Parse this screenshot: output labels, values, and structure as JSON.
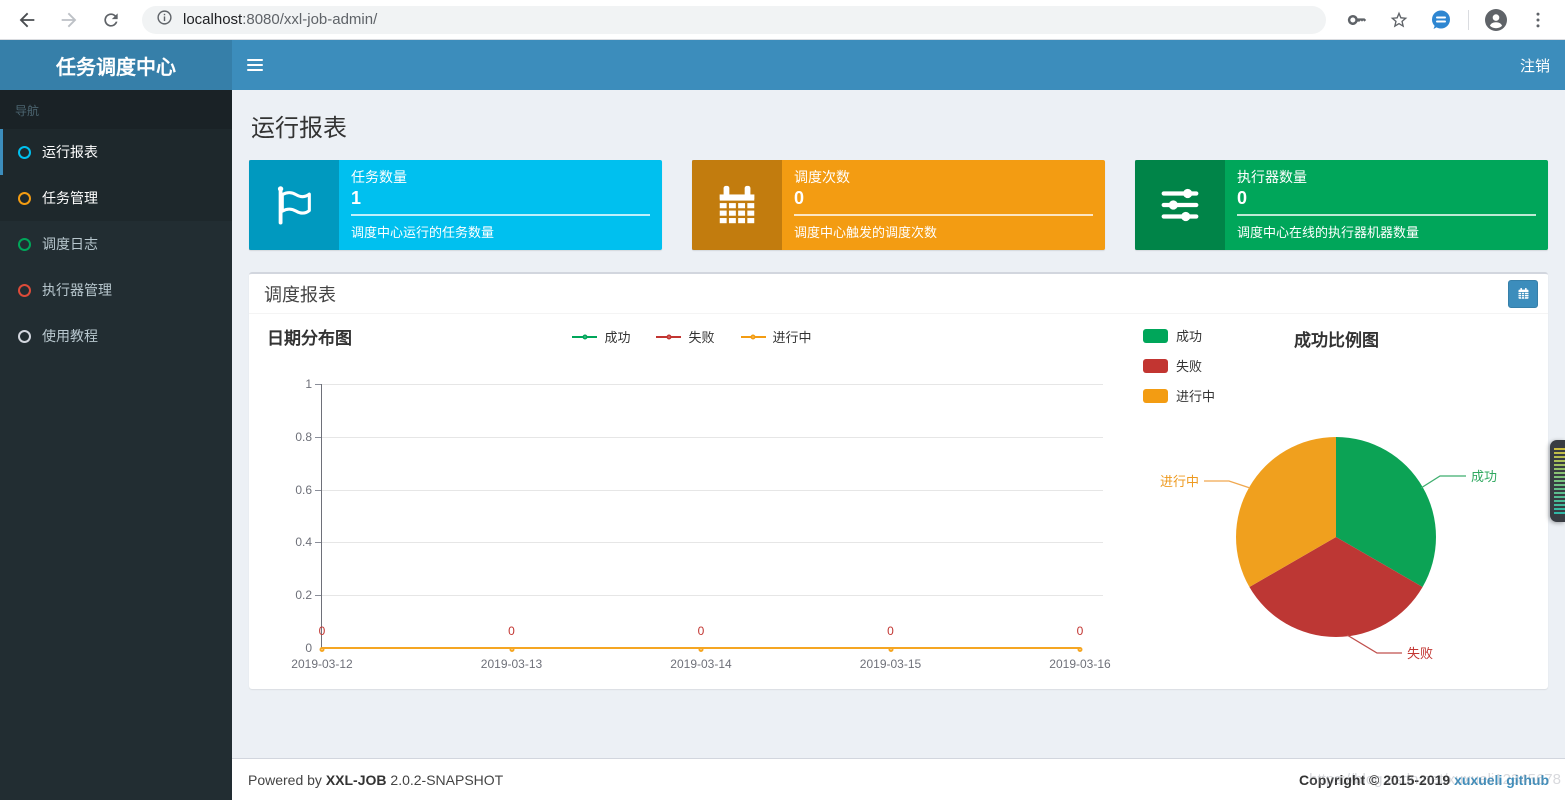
{
  "browser": {
    "url_host": "localhost",
    "url_rest": ":8080/xxl-job-admin/"
  },
  "navbar": {
    "title": "任务调度中心",
    "logout_label": "注销"
  },
  "sidebar": {
    "header": "导航",
    "items": [
      {
        "label": "运行报表",
        "icon_color": "#00c0ef",
        "active": true
      },
      {
        "label": "任务管理",
        "icon_color": "#f39c12",
        "active": false
      },
      {
        "label": "调度日志",
        "icon_color": "#00a65a",
        "active": false
      },
      {
        "label": "执行器管理",
        "icon_color": "#dd4b39",
        "active": false
      },
      {
        "label": "使用教程",
        "icon_color": "#d2d6de",
        "active": false
      }
    ]
  },
  "page": {
    "title": "运行报表"
  },
  "stat_cards": [
    {
      "label": "任务数量",
      "value": "1",
      "desc": "调度中心运行的任务数量",
      "color": "#00c0ef",
      "icon": "flag-icon"
    },
    {
      "label": "调度次数",
      "value": "0",
      "desc": "调度中心触发的调度次数",
      "color": "#f39c12",
      "icon": "calendar-icon"
    },
    {
      "label": "执行器数量",
      "value": "0",
      "desc": "调度中心在线的执行器机器数量",
      "color": "#00a65a",
      "icon": "sliders-icon"
    }
  ],
  "panel": {
    "title": "调度报表"
  },
  "chart_data": [
    {
      "type": "line",
      "title": "日期分布图",
      "x": [
        "2019-03-12",
        "2019-03-13",
        "2019-03-14",
        "2019-03-15",
        "2019-03-16"
      ],
      "series": [
        {
          "name": "成功",
          "color": "#00a65a",
          "values": [
            0,
            0,
            0,
            0,
            0
          ]
        },
        {
          "name": "失败",
          "color": "#c23531",
          "values": [
            0,
            0,
            0,
            0,
            0
          ]
        },
        {
          "name": "进行中",
          "color": "#f39c12",
          "values": [
            0,
            0,
            0,
            0,
            0
          ]
        }
      ],
      "ylim": [
        0,
        1
      ],
      "yticks": [
        "1",
        "0.8",
        "0.6",
        "0.4",
        "0.2",
        "0"
      ],
      "grid": true,
      "legend_position": "top-center",
      "point_labels": [
        "0",
        "0",
        "0",
        "0",
        "0"
      ],
      "point_label_color": "#c23531"
    },
    {
      "type": "pie",
      "title": "成功比例图",
      "legend_position": "top-left",
      "slices": [
        {
          "name": "成功",
          "ratio": 0.3333,
          "color": "#00a65a"
        },
        {
          "name": "失败",
          "ratio": 0.3333,
          "color": "#c23531"
        },
        {
          "name": "进行中",
          "ratio": 0.3333,
          "color": "#f39c12"
        }
      ]
    }
  ],
  "footer": {
    "powered_prefix": "Powered by",
    "brand": "XXL-JOB",
    "version": "2.0.2-SNAPSHOT",
    "copyright": "Copyright © 2015-2019",
    "link_author": "xuxueli",
    "link_repo": "github",
    "watermark": "https://blog.csdn.net/xuxueli12345678"
  },
  "colors": {
    "navbar": "#3c8dbc",
    "navbar_logo": "#367fa9",
    "sidebar": "#222d32",
    "sidebar_active_bg": "#1e282c",
    "content_bg": "#ecf0f5",
    "card_aqua": "#00c0ef",
    "card_yellow": "#f39c12",
    "card_green": "#00a65a",
    "success": "#00a65a",
    "fail": "#c23531",
    "running": "#f39c12"
  }
}
